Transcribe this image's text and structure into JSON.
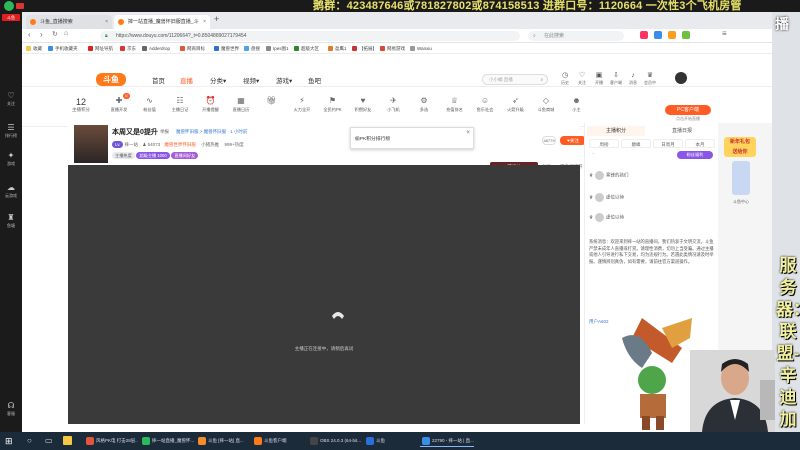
{
  "overlay": {
    "banner_text": "鹅群：423487646或781827802或874158513    进群口号：1120664    一次性3个飞机房管",
    "side_vertical_text": "服务器：联盟-辛迪加",
    "title_corner": "播"
  },
  "rail": {
    "items": [
      {
        "label": "关注",
        "icon": "heart-icon"
      },
      {
        "label": "排行榜",
        "icon": "rank-icon"
      },
      {
        "label": "游戏",
        "icon": "gamepad-icon"
      },
      {
        "label": "云游戏",
        "icon": "cloud-icon"
      },
      {
        "label": "鱼塘",
        "icon": "trophy-icon"
      },
      {
        "label": "客服",
        "icon": "headset-icon"
      }
    ]
  },
  "browser": {
    "tabs": [
      {
        "title": "斗鱼_直播搜索",
        "active": false
      },
      {
        "title": "摔一站直播_魔兽怀旧服直播_斗",
        "active": true
      }
    ],
    "url": "https://www.douyu.com/1120664?_t=0.8504889027179454",
    "search_placeholder": "在此搜索",
    "bookmarks": [
      "收藏",
      "手机收藏夹",
      "网址导航",
      "京东",
      "Adderdrop",
      "网商目标",
      "魔兽世界",
      "盘搜",
      "Ipes图1",
      "超级大区",
      "盈鹰1",
      "【拓展】",
      "网易游戏",
      "Wanxiu"
    ]
  },
  "site": {
    "logo": "斗鱼",
    "nav": [
      "首页",
      "直播",
      "分类",
      "视频",
      "游戏",
      "鱼吧"
    ],
    "nav_active": "直播",
    "search_placeholder": "小小橘 直播",
    "header_icons": [
      {
        "label": "历史",
        "icon": "clock-icon"
      },
      {
        "label": "关注",
        "icon": "heart-icon"
      },
      {
        "label": "开播",
        "icon": "camera-icon"
      },
      {
        "label": "客户端",
        "icon": "download-icon"
      },
      {
        "label": "消息",
        "icon": "bell-icon"
      },
      {
        "label": "会员中心",
        "icon": "crown-icon"
      }
    ]
  },
  "category_row": {
    "big_number": "12",
    "big_label": "主播积分",
    "items": [
      "直播开发",
      "粉丝值",
      "主播日记",
      "开播提醒",
      "直播日历",
      "",
      "火力全开",
      "全民钓PK",
      "积攒好友",
      "小飞机",
      "多选",
      "充值排名",
      "鱼乐社会",
      "火箭升级",
      "斗鱼商城",
      "小主"
    ],
    "cat_badge": "6",
    "pc_button": "PC客户端",
    "pc_sub": "点击开始直播"
  },
  "popup": {
    "text": "偷PK积分排行榜"
  },
  "streamer": {
    "title": "本周又是0提升",
    "meta_tags": [
      "举报",
      "风景制作"
    ],
    "meta_line": "魔兽怀旧服 > 魔兽怀旧服 · 1 小时前",
    "name": "摔一站",
    "fans": "54073",
    "level_pill": "Lv.",
    "subtitle": "魔兽世界怀旧服",
    "hot_label": "小猪热推",
    "extra": "999+热度",
    "top_score": "48779",
    "follow_label": "关注",
    "pills": [
      "主播热度",
      "超级主播 1000",
      "直播间好友"
    ],
    "fight_label": "可战斗",
    "share": "分享",
    "client": "客户端打开"
  },
  "video": {
    "message": "主播正在连接中，请稍后再试"
  },
  "right_panel": {
    "tabs": [
      "主播积分",
      "直播日报"
    ],
    "sub_tabs": [
      "周榜",
      "巅峰",
      "日周月",
      "本月"
    ],
    "button": "粉丝福利",
    "ranks": [
      {
        "name": "寒锋的孩们",
        "score": ""
      },
      {
        "name": "虚位以待",
        "score": ""
      },
      {
        "name": "虚位以待",
        "score": ""
      }
    ],
    "system_message": "系统消息：欢迎来到摔一站的直播间，我们热衷于文明交流，斗鱼严禁未成年人直播或打赏。请理性消费，切勿上当受骗。通过主播或他人引导进行私下交易，均为违规行为。若遇此类情况请及时举报。谨慎辨别真伪，如有需要，请前往官方渠道操作。",
    "user_line": "用户A602"
  },
  "ads": {
    "text1": "新年礼包",
    "text2": "送给你",
    "text3": "斗鱼中心"
  },
  "taskbar": {
    "items": [
      "风格PK电 打击28层...",
      "摔一站直播_魔兽怀...",
      "斗鱼 [摔一站] 直...",
      "斗鱼客户端",
      "OBS 24.0.3 (64-bit...",
      "斗鱼",
      "22790 - 摔一站 | 直..."
    ],
    "time": "",
    "date": ""
  }
}
